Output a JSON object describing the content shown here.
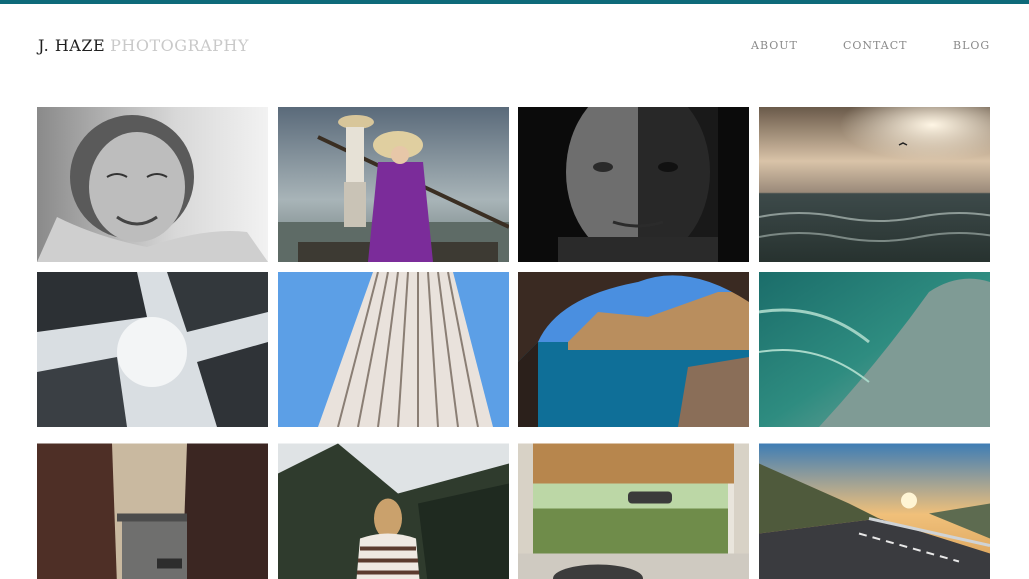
{
  "header": {
    "brand_name": "J. HAZE",
    "brand_sub": "PHOTOGRAPHY",
    "accent_color": "#0e6a7a"
  },
  "nav": {
    "items": [
      "ABOUT",
      "CONTACT",
      "BLOG"
    ]
  },
  "gallery": {
    "photos": [
      "elderly-woman-smiling-bw",
      "women-in-ao-dai-on-boat",
      "man-half-shadow-portrait",
      "stormy-sea-sunset",
      "skyscrapers-looking-up-fog",
      "tall-building-facade-blue-sky",
      "sea-cave-coastline",
      "ocean-wave-curl",
      "misty-city-canal",
      "woman-facing-mountains",
      "vintage-car-interior",
      "mountain-road-sunset"
    ]
  }
}
